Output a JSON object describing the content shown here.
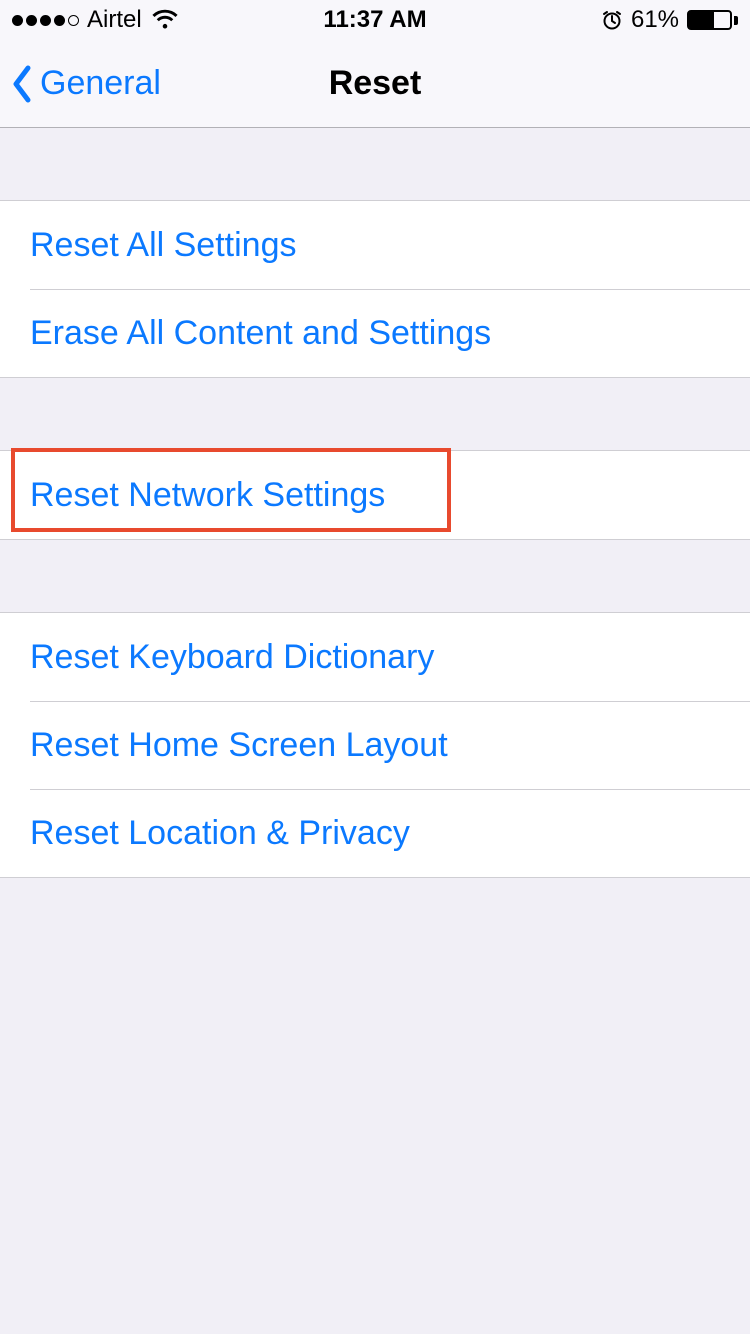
{
  "status": {
    "carrier": "Airtel",
    "time": "11:37 AM",
    "battery_percent": "61%",
    "battery_level": 61
  },
  "nav": {
    "back_label": "General",
    "title": "Reset"
  },
  "sections": {
    "group1": {
      "item0": "Reset All Settings",
      "item1": "Erase All Content and Settings"
    },
    "group2": {
      "item0": "Reset Network Settings"
    },
    "group3": {
      "item0": "Reset Keyboard Dictionary",
      "item1": "Reset Home Screen Layout",
      "item2": "Reset Location & Privacy"
    }
  }
}
